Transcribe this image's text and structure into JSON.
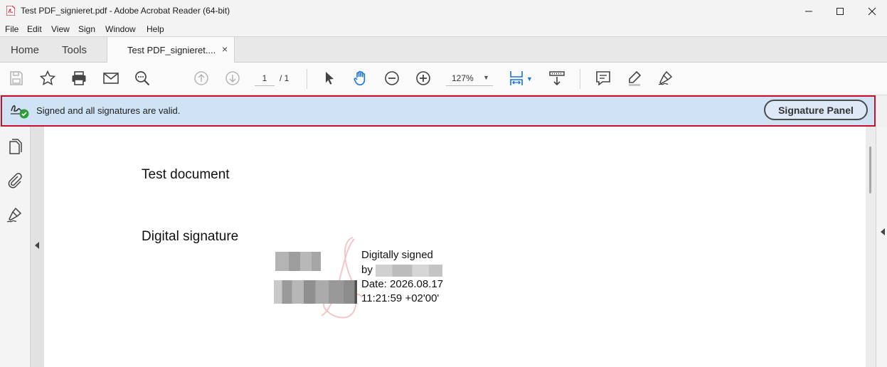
{
  "window": {
    "title": "Test PDF_signieret.pdf - Adobe Acrobat Reader (64-bit)"
  },
  "menu": [
    "File",
    "Edit",
    "View",
    "Sign",
    "Window",
    "Help"
  ],
  "tabs": {
    "home": "Home",
    "tools": "Tools",
    "document": "Test PDF_signieret....",
    "close": "×"
  },
  "toolbar": {
    "page_current": "1",
    "page_total": "/ 1",
    "zoom": "127%"
  },
  "signature_bar": {
    "message": "Signed and all signatures are valid.",
    "panel_button": "Signature Panel"
  },
  "document": {
    "heading1": "Test document",
    "heading2": "Digital signature",
    "signature_lines": [
      "Digitally signed",
      "by",
      "Date: 2026.08.17",
      "11:21:59 +02'00'"
    ]
  },
  "colors": {
    "highlight_border": "#c8102e",
    "signature_bar_bg": "#cfe3f5",
    "accent_blue": "#1473e6",
    "valid_green": "#2d9d3a"
  }
}
